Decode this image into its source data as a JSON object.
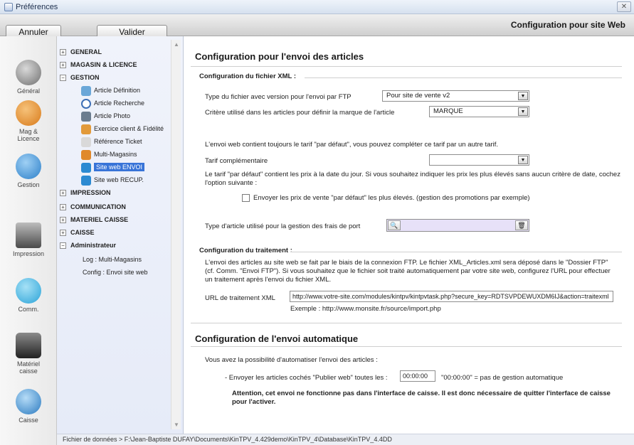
{
  "window": {
    "title": "Préférences",
    "close_glyph": "✕"
  },
  "toolbar": {
    "cancel_label": "Annuler",
    "validate_label": "Valider",
    "page_heading": "Configuration pour site Web"
  },
  "categories": [
    {
      "label": "Général",
      "icon": "gears-icon",
      "color": "#6f6f6f"
    },
    {
      "label": "Mag &\nLicence",
      "icon": "store-icon",
      "color": "#d87a1a"
    },
    {
      "label": "Gestion",
      "icon": "globe-icon",
      "color": "#2c7fc9"
    },
    {
      "label": "Impression",
      "icon": "printer-icon",
      "color": "#4a4a4a"
    },
    {
      "label": "Comm.",
      "icon": "network-icon",
      "color": "#2aa3d8"
    },
    {
      "label": "Matériel\ncaisse",
      "icon": "register-icon",
      "color": "#222222"
    },
    {
      "label": "Caisse",
      "icon": "cash-icon",
      "color": "#2a7ac0"
    }
  ],
  "tree": {
    "general": "GENERAL",
    "magasin": "MAGASIN & LICENCE",
    "gestion": "GESTION",
    "gestion_items": [
      "Article Définition",
      "Article Recherche",
      "Article Photo",
      "Exercice client & Fidélité",
      "Référence Ticket",
      "Multi-Magasins",
      "Site web ENVOI",
      "Site web RECUP."
    ],
    "impression": "IMPRESSION",
    "communication": "COMMUNICATION",
    "materiel": "MATERIEL CAISSE",
    "caisse": "CAISSE",
    "administrateur": "Administrateur",
    "admin_items": [
      "Log : Multi-Magasins",
      "Config : Envoi site web"
    ],
    "expand_glyph": "+",
    "collapse_glyph": "−"
  },
  "main": {
    "section1_title": "Configuration pour l'envoi des articles",
    "xml_subtitle": "Configuration du fichier XML :",
    "ftp_type_label": "Type du fichier avec version pour l'envoi par FTP",
    "ftp_type_value": "Pour site de vente v2",
    "brand_criterion_label": "Critère utilisé dans les articles pour définir la marque de l'article",
    "brand_criterion_value": "MARQUE",
    "default_price_note": "L'envoi web contient toujours le tarif \"par défaut\", vous pouvez compléter ce tarif par un autre tarif.",
    "extra_price_label": "Tarif complémentaire",
    "extra_price_value": "",
    "default_price_explain": "Le tarif \"par défaut\" contient les prix à la date du jour. Si vous souhaitez indiquer les prix les plus élevés sans aucun critère de date, cochez l'option suivante :",
    "highest_price_checkbox": "Envoyer les prix de vente \"par défaut\" les plus élevés. (gestion des promotions par exemple)",
    "shipping_type_label": "Type d'article utilisé pour la gestion des frais de port",
    "treatment_subtitle": "Configuration du traitement :",
    "treatment_text": "L'envoi des articles au site web se fait par le biais de la connexion FTP. Le fichier XML_Articles.xml sera déposé dans le \"Dossier FTP\" (cf. Comm. \"Envoi FTP\"). Si vous souhaitez que le fichier soit traité automatiquement par votre site web, configurez l'URL pour effectuer un traitement après l'envoi du fichier XML.",
    "xml_url_label": "URL de traitement XML",
    "xml_url_value": "http://www.votre-site.com/modules/kintpv/kintpvtask.php?secure_key=RDTSVPDEWUXDM6IJ&action=traitexml",
    "xml_url_example": "Exemple : http://www.monsite.fr/source/import.php",
    "section2_title": "Configuration de l'envoi automatique",
    "auto_intro": "Vous avez la possibilité d'automatiser l'envoi des articles :",
    "auto_send_label": "- Envoyer les articles cochés \"Publier web\" toutes les :",
    "auto_send_value": "00:00:00",
    "auto_send_note": "\"00:00:00\" = pas de gestion automatique",
    "warning": "Attention, cet envoi ne fonctionne pas dans l'interface de caisse. Il est donc nécessaire de quitter l'interface de caisse pour l'activer."
  },
  "footer": {
    "path": "Fichier de données > F:\\Jean-Baptiste DUFAY\\Documents\\KinTPV_4.429demo\\KinTPV_4\\Database\\KinTPV_4.4DD"
  },
  "colors": {
    "selection": "#3874d8",
    "tree_bg": "#e9edf9",
    "lookup_bg": "#e7e1f8"
  }
}
